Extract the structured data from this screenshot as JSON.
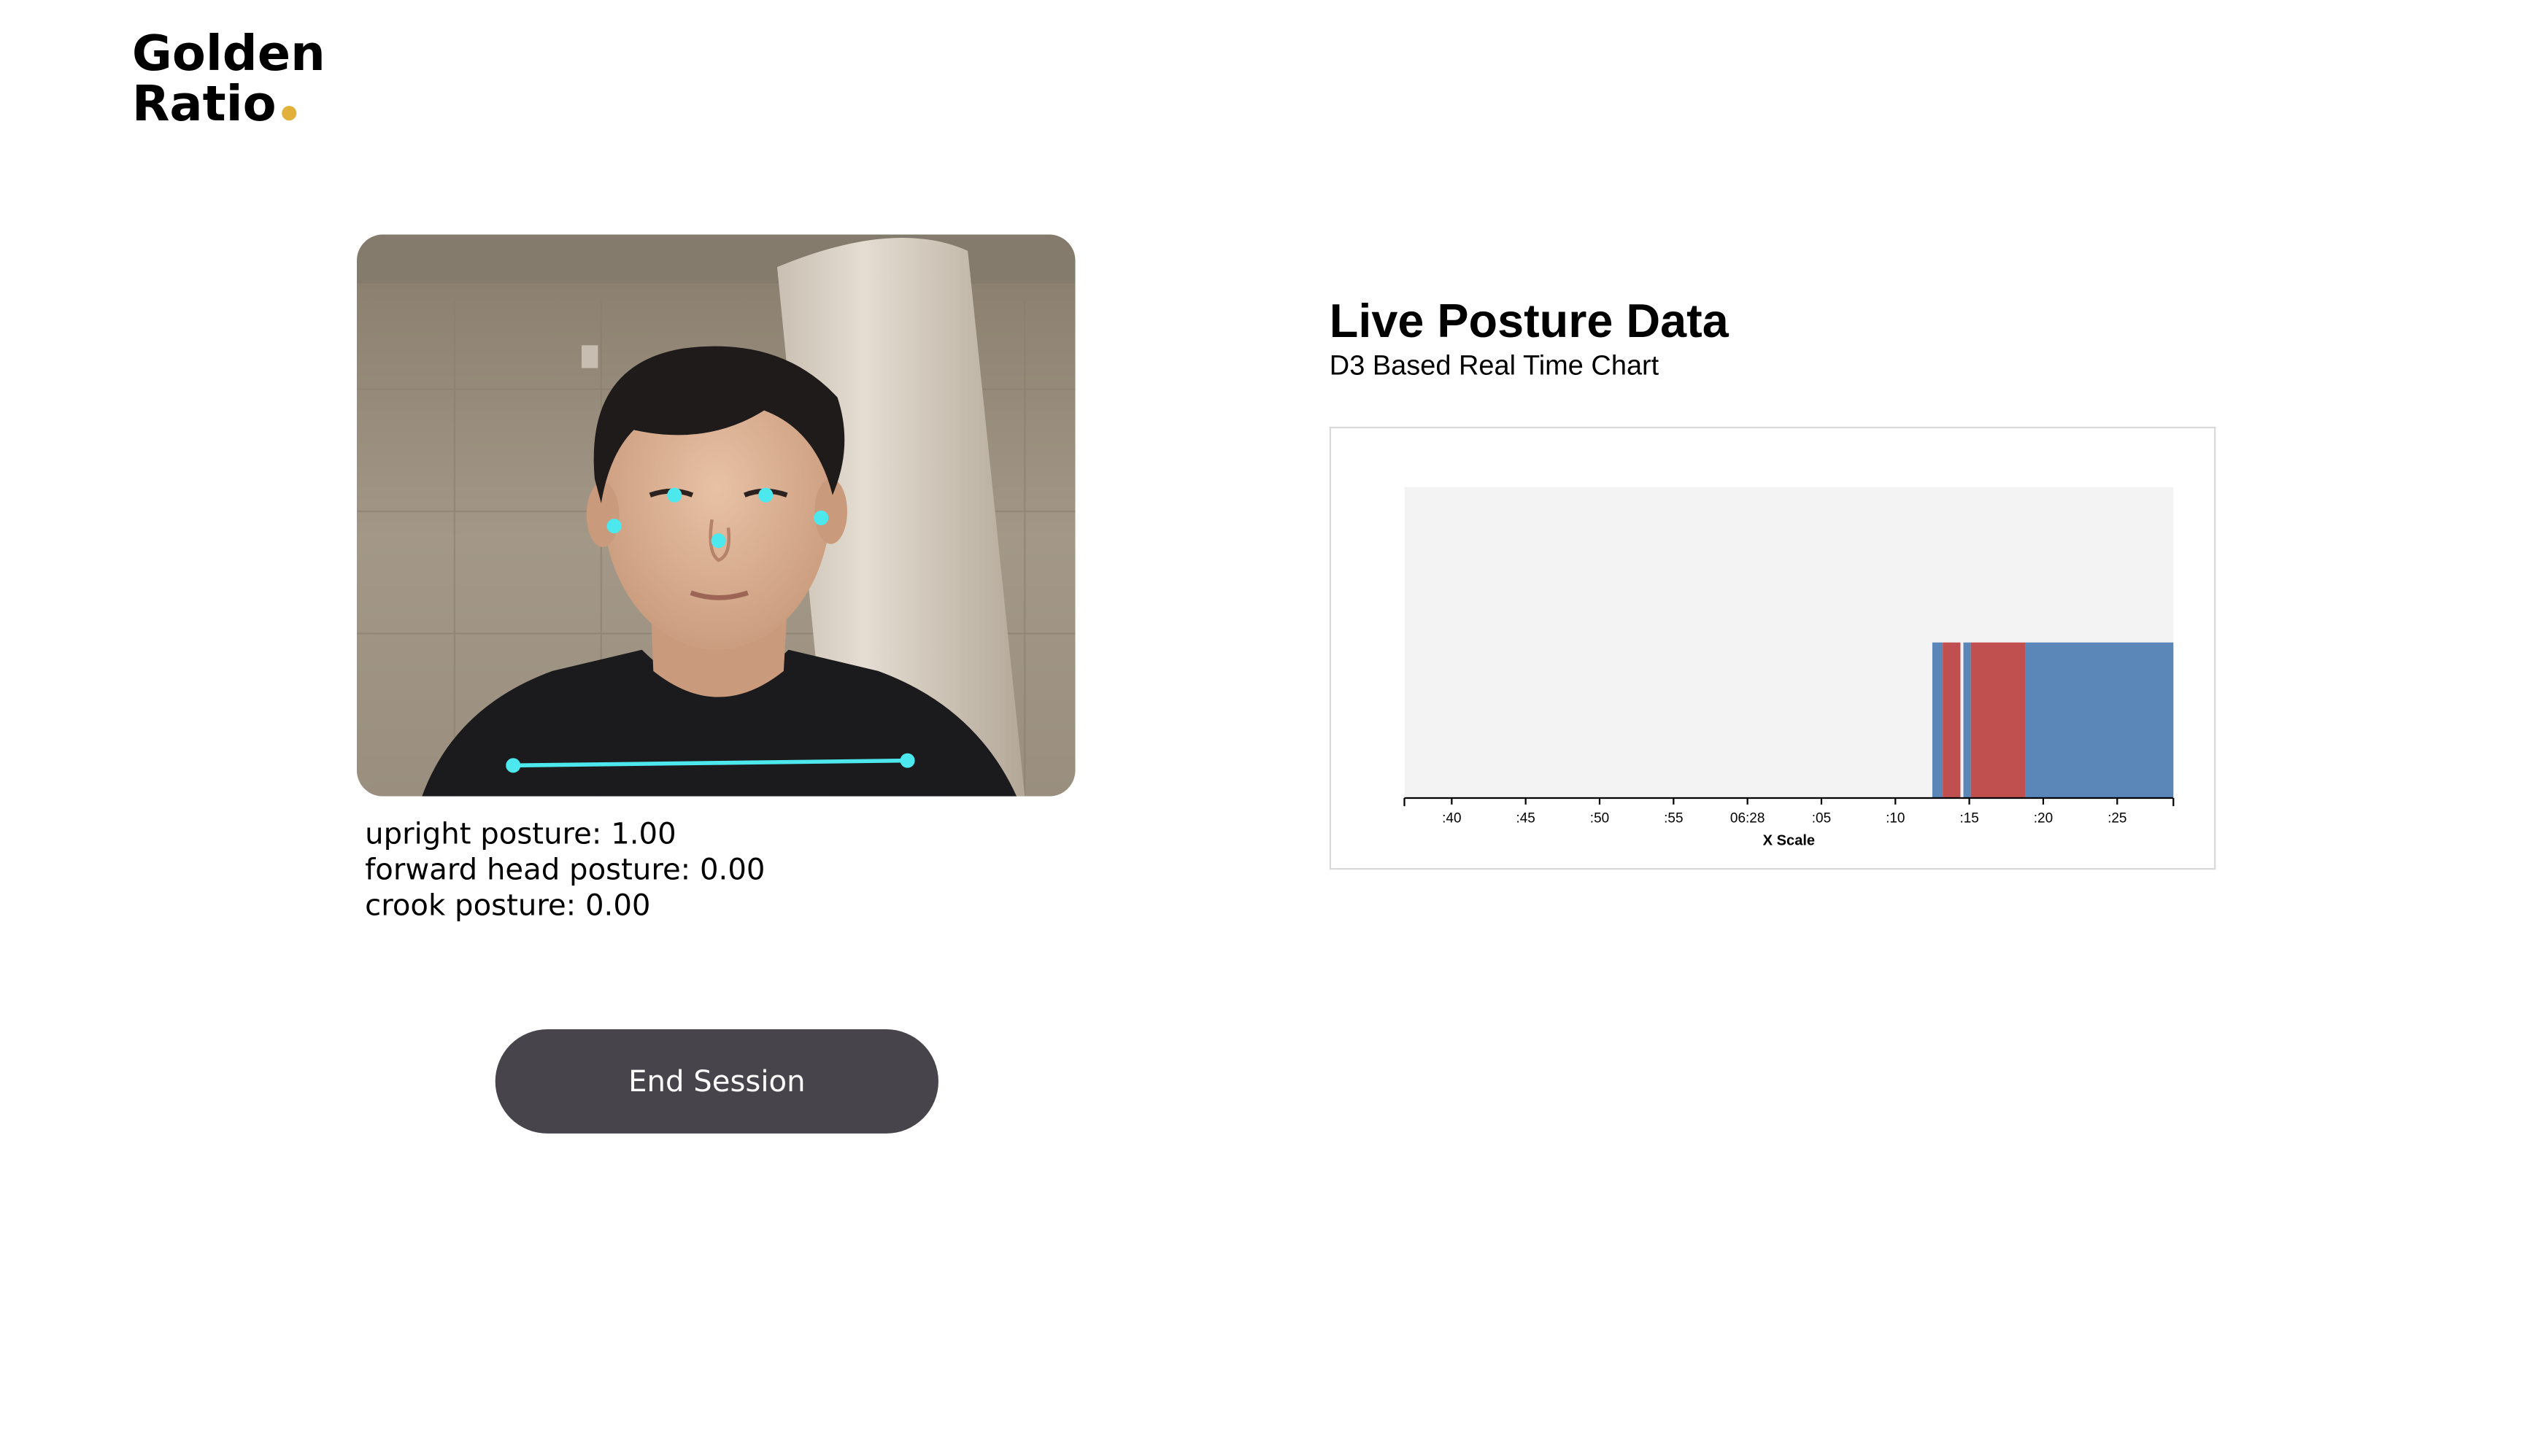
{
  "logo": {
    "line1": "Golden",
    "line2": "Ratio",
    "dot_color": "#e2b13c"
  },
  "camera": {
    "landmark_color": "#4de8ee"
  },
  "readouts": {
    "upright": "upright posture: 1.00",
    "forward_head": "forward head posture: 0.00",
    "crook": "crook posture: 0.00"
  },
  "controls": {
    "end_session_label": "End Session"
  },
  "chart_header": {
    "title": "Live Posture Data",
    "subtitle": "D3 Based Real Time Chart"
  },
  "chart_data": {
    "type": "bar",
    "xlabel": "X Scale",
    "tick_labels": [
      ":40",
      ":45",
      ":50",
      ":55",
      "06:28",
      ":05",
      ":10",
      ":15",
      ":20",
      ":25"
    ],
    "x_domain_seconds": [
      36.8,
      88.8
    ],
    "series": [
      {
        "color": "#5a86b8",
        "segments": [
          {
            "start": 72.5,
            "end": 73.2
          },
          {
            "start": 74.6,
            "end": 75.1
          },
          {
            "start": 78.8,
            "end": 88.8
          }
        ]
      },
      {
        "color": "#c0504f",
        "segments": [
          {
            "start": 73.2,
            "end": 74.4
          },
          {
            "start": 75.1,
            "end": 78.8
          }
        ]
      }
    ],
    "fill_level": 0.5,
    "colors": {
      "plot_background": "#f3f3f3",
      "upright": "#5a86b8",
      "bad": "#c0504f"
    }
  }
}
